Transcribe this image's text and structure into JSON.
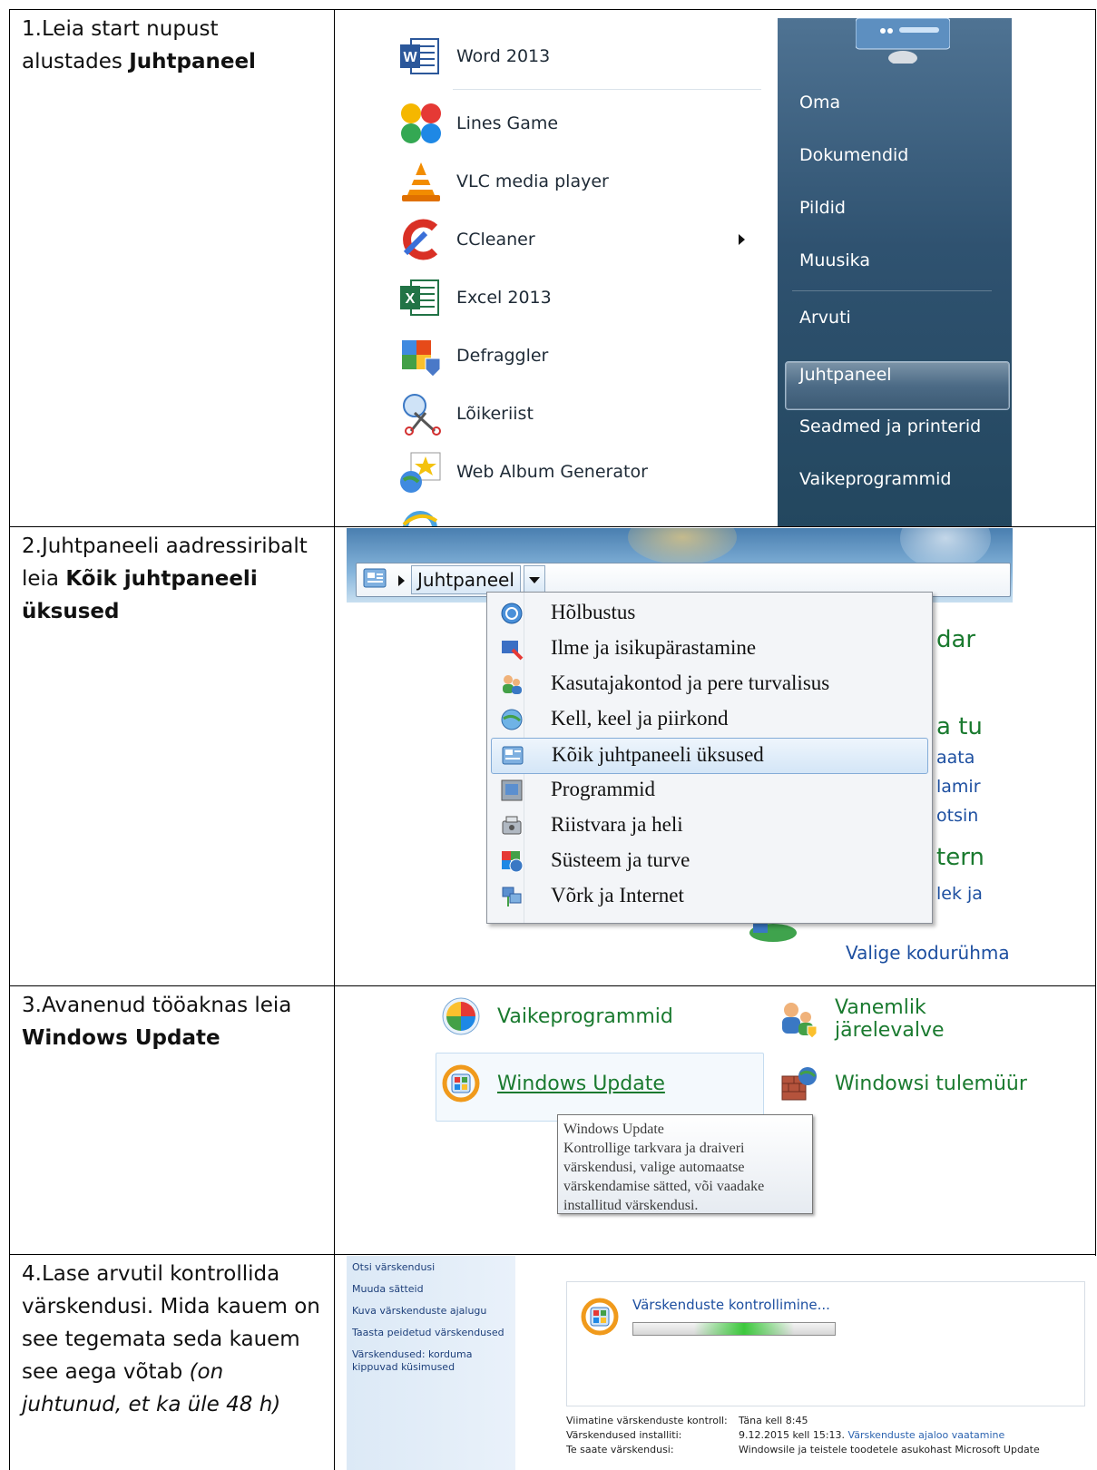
{
  "steps": [
    {
      "pre": "1.Leia start nupust alustades ",
      "bold": "Juhtpaneel"
    },
    {
      "pre": "2.Juhtpaneeli aadressiribalt leia ",
      "bold": "Kõik juhtpaneeli üksused"
    },
    {
      "pre": "3.Avanenud tööaknas leia ",
      "bold": "Windows Update"
    },
    {
      "pre": "4.Lase arvutil kontrollida värskendusi. Mida kauem on see tegemata seda kauem see aega võtab ",
      "italic": "(on juhtunud, et ka üle 48 h)"
    }
  ],
  "start_menu": {
    "programs": [
      {
        "label": "Word 2013",
        "icon": "word-icon"
      },
      {
        "label": "Lines Game",
        "icon": "lines-game-icon"
      },
      {
        "label": "VLC media player",
        "icon": "vlc-icon"
      },
      {
        "label": "CCleaner",
        "icon": "ccleaner-icon"
      },
      {
        "label": "Excel 2013",
        "icon": "excel-icon"
      },
      {
        "label": "Defraggler",
        "icon": "defraggler-icon"
      },
      {
        "label": "Lõikeriist",
        "icon": "snipping-tool-icon"
      },
      {
        "label": "Web Album Generator",
        "icon": "web-album-icon"
      }
    ],
    "places": [
      "Oma",
      "Dokumendid",
      "Pildid",
      "Muusika",
      "Arvuti",
      "Juhtpaneel",
      "Seadmed ja printerid",
      "Vaikeprogrammid"
    ],
    "selected_place": "Juhtpaneel"
  },
  "control_panel_menu": {
    "breadcrumb": "Juhtpaneel",
    "items": [
      {
        "label": "Hõlbustus",
        "icon": "ease-of-access-icon"
      },
      {
        "label": "Ilme ja isikupärastamine",
        "icon": "appearance-icon"
      },
      {
        "label": "Kasutajakontod ja pere turvalisus",
        "icon": "user-accounts-icon"
      },
      {
        "label": "Kell, keel ja piirkond",
        "icon": "clock-region-icon"
      },
      {
        "label": "Kõik juhtpaneeli üksused",
        "icon": "all-items-icon"
      },
      {
        "label": "Programmid",
        "icon": "programs-icon"
      },
      {
        "label": "Riistvara ja heli",
        "icon": "hardware-sound-icon"
      },
      {
        "label": "Süsteem ja turve",
        "icon": "system-security-icon"
      },
      {
        "label": "Võrk ja Internet",
        "icon": "network-icon"
      }
    ],
    "selected": "Kõik juhtpaneeli üksused",
    "background_fragments": [
      "dar",
      "a tu",
      "aata",
      "lamir",
      "otsin",
      "tern",
      "lek ja"
    ],
    "background_link": "Valige kodurühma"
  },
  "control_panel_items": {
    "vaikeprogrammid": "Vaikeprogrammid",
    "vanemlik": "Vanemlik järelevalve",
    "windows_update": "Windows Update",
    "tulemuur": "Windowsi tulemüür",
    "tooltip_title": "Windows Update",
    "tooltip_body": "Kontrollige tarkvara ja draiveri värskendusi, valige automaatse värskendamise sätted, või vaadake installitud värskendusi."
  },
  "windows_update": {
    "sidebar_links": [
      "Otsi värskendusi",
      "Muuda sätteid",
      "Kuva värskenduste ajalugu",
      "Taasta peidetud värskendused",
      "Värskendused: korduma kippuvad küsimused"
    ],
    "status_title": "Värskenduste kontrollimine...",
    "progress_fraction": 0.55,
    "info": [
      {
        "label": "Viimatine värskenduste kontroll:",
        "value": "Täna kell 8:45",
        "link": ""
      },
      {
        "label": "Värskendused installiti:",
        "value": "9.12.2015 kell 15:13.",
        "link": "Värskenduste ajaloo vaatamine"
      },
      {
        "label": "Te saate värskendusi:",
        "value": "Windowsile ja teistele toodetele asukohast Microsoft Update",
        "link": ""
      }
    ]
  }
}
